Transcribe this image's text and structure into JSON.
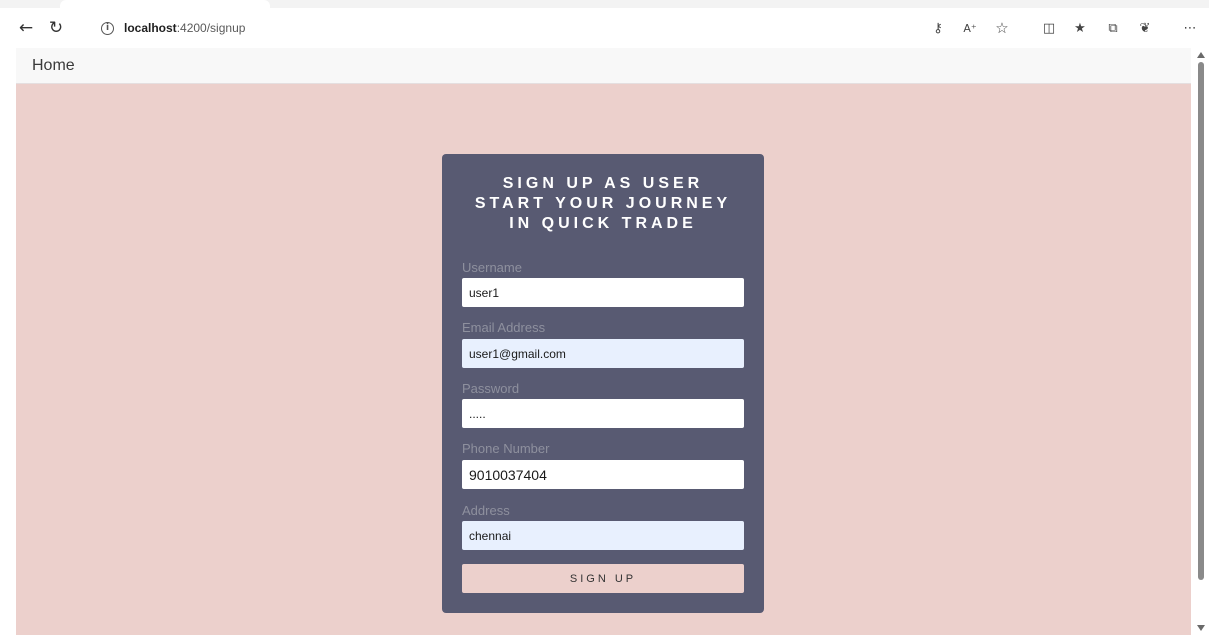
{
  "browser": {
    "url_host": "localhost",
    "url_path": ":4200/signup",
    "icons": [
      "back-arrow-icon",
      "reload-icon",
      "info-icon",
      "key-icon",
      "read-aloud-icon",
      "favorite-star-icon",
      "split-screen-icon",
      "favorites-icon",
      "collections-icon",
      "extensions-icon",
      "more-icon"
    ]
  },
  "nav": {
    "home_label": "Home"
  },
  "signup": {
    "title_line1": "SIGN UP AS USER",
    "title_line2": "START YOUR JOURNEY",
    "title_line3": "IN QUICK TRADE",
    "username_label": "Username",
    "username_value": "user1",
    "email_label": "Email Address",
    "email_value": "user1@gmail.com",
    "password_label": "Password",
    "password_value": ".....",
    "phone_label": "Phone Number",
    "phone_value": "9010037404",
    "address_label": "Address",
    "address_value": "chennai",
    "submit_label": "SIGN UP"
  },
  "colors": {
    "page_background": "#ecd0cc",
    "card_background": "#585a72",
    "autofill_background": "#e8f0fe"
  }
}
